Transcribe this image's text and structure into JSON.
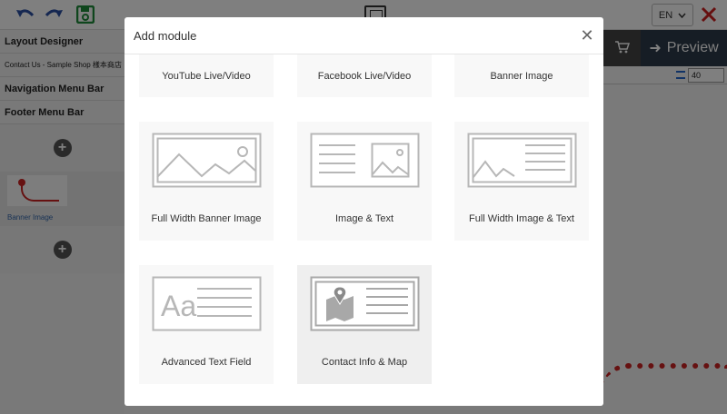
{
  "toolbar": {
    "lang": "EN",
    "icons": [
      "undo-icon",
      "redo-icon",
      "save-icon",
      "close-icon"
    ]
  },
  "sidebar": {
    "title": "Layout Designer",
    "page": "Contact Us - Sample Shop 樣本商店",
    "nav_menu": "Navigation Menu Bar",
    "footer_menu": "Footer Menu Bar",
    "banner_label": "Banner Image"
  },
  "canvas": {
    "preview_label": "Preview",
    "size_value": "40"
  },
  "modal": {
    "title": "Add module",
    "close_icon": "close-icon",
    "modules": [
      {
        "label": "YouTube Live/Video",
        "icon": "youtube-icon"
      },
      {
        "label": "Facebook Live/Video",
        "icon": "facebook-icon"
      },
      {
        "label": "Banner Image",
        "icon": "banner-image-icon"
      },
      {
        "label": "Full Width Banner Image",
        "icon": "full-width-banner-icon"
      },
      {
        "label": "Image & Text",
        "icon": "image-text-icon"
      },
      {
        "label": "Full Width Image & Text",
        "icon": "full-width-image-text-icon"
      },
      {
        "label": "Advanced Text Field",
        "icon": "text-field-icon"
      },
      {
        "label": "Contact Info & Map",
        "icon": "contact-map-icon"
      }
    ]
  },
  "colors": {
    "accent_blue": "#2b4fa2",
    "save_green": "#1e8c3a",
    "close_red": "#cc1f1f",
    "illustration_grey": "#b7b7b7"
  }
}
